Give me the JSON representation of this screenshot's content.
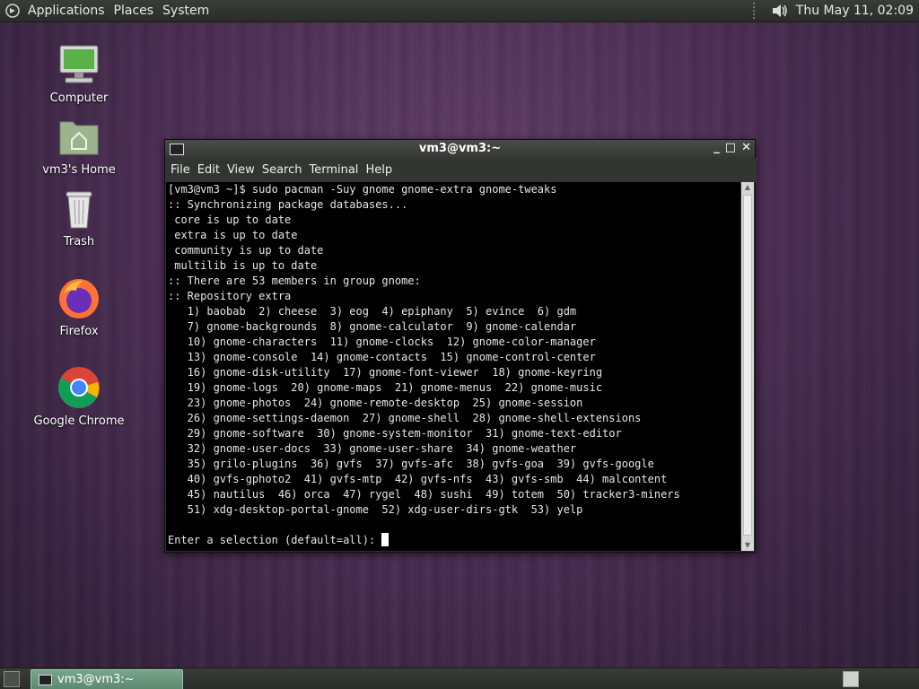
{
  "top_panel": {
    "menus": [
      "Applications",
      "Places",
      "System"
    ],
    "clock": "Thu May 11, 02:09"
  },
  "desktop_icons": [
    {
      "label": "Computer",
      "icon": "computer-icon"
    },
    {
      "label": "vm3's Home",
      "icon": "home-folder-icon"
    },
    {
      "label": "Trash",
      "icon": "trash-icon"
    },
    {
      "label": "Firefox",
      "icon": "firefox-icon"
    },
    {
      "label": "Google Chrome",
      "icon": "chrome-icon"
    }
  ],
  "terminal": {
    "title": "vm3@vm3:~",
    "menu": [
      "File",
      "Edit",
      "View",
      "Search",
      "Terminal",
      "Help"
    ],
    "lines": [
      "[vm3@vm3 ~]$ sudo pacman -Suy gnome gnome-extra gnome-tweaks",
      ":: Synchronizing package databases...",
      " core is up to date",
      " extra is up to date",
      " community is up to date",
      " multilib is up to date",
      ":: There are 53 members in group gnome:",
      ":: Repository extra",
      "   1) baobab  2) cheese  3) eog  4) epiphany  5) evince  6) gdm",
      "   7) gnome-backgrounds  8) gnome-calculator  9) gnome-calendar",
      "   10) gnome-characters  11) gnome-clocks  12) gnome-color-manager",
      "   13) gnome-console  14) gnome-contacts  15) gnome-control-center",
      "   16) gnome-disk-utility  17) gnome-font-viewer  18) gnome-keyring",
      "   19) gnome-logs  20) gnome-maps  21) gnome-menus  22) gnome-music",
      "   23) gnome-photos  24) gnome-remote-desktop  25) gnome-session",
      "   26) gnome-settings-daemon  27) gnome-shell  28) gnome-shell-extensions",
      "   29) gnome-software  30) gnome-system-monitor  31) gnome-text-editor",
      "   32) gnome-user-docs  33) gnome-user-share  34) gnome-weather",
      "   35) grilo-plugins  36) gvfs  37) gvfs-afc  38) gvfs-goa  39) gvfs-google",
      "   40) gvfs-gphoto2  41) gvfs-mtp  42) gvfs-nfs  43) gvfs-smb  44) malcontent",
      "   45) nautilus  46) orca  47) rygel  48) sushi  49) totem  50) tracker3-miners",
      "   51) xdg-desktop-portal-gnome  52) xdg-user-dirs-gtk  53) yelp",
      ""
    ],
    "prompt": "Enter a selection (default=all): "
  },
  "taskbar": {
    "window_button": "vm3@vm3:~"
  },
  "colors": {
    "panel": "#2f312f",
    "terminal_bg": "#000000",
    "terminal_fg": "#e6e6e6",
    "task_active": "#6a957d"
  }
}
